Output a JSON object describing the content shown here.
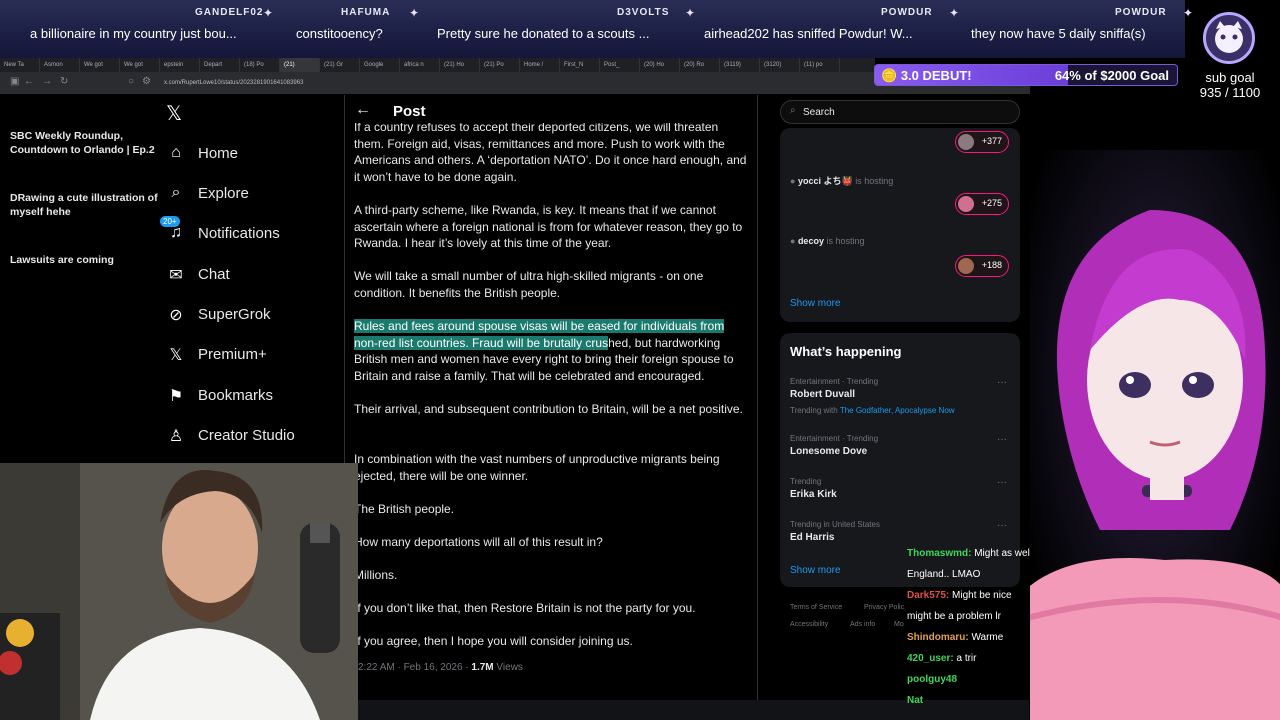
{
  "ticker": [
    {
      "user": "",
      "message": "a billionaire in my country just bou...",
      "userX": 0,
      "msgX": 30
    },
    {
      "user": "GANDELF02",
      "message": "constitooency?",
      "userX": 195,
      "msgX": 296
    },
    {
      "user": "HAFUMA",
      "message": "Pretty sure he donated to a scouts ...",
      "userX": 341,
      "msgX": 437
    },
    {
      "user": "D3VOLTS",
      "message": "airhead202 has sniffed Powdur! W...",
      "userX": 617,
      "msgX": 704
    },
    {
      "user": "POWDUR",
      "message": "they now have 5 daily sniffa(s)",
      "userX": 881,
      "msgX": 971
    },
    {
      "user": "POWDUR",
      "message": "",
      "userX": 1115,
      "msgX": 1185
    }
  ],
  "browser": {
    "tabs": [
      "New Ta",
      "Asmon",
      "We got",
      "We got",
      "epstein",
      "Depart",
      "(18) Po",
      "(21)",
      "(21) Gr",
      "Google",
      "africa n",
      "(21) Ho",
      "(21) Po",
      "Home /",
      "First_N",
      "Post_",
      "(20) Ho",
      "(20) Ro",
      "(3119)",
      "(3120)",
      "(11) po"
    ],
    "url": "x.com/RupertLowe10/status/2023281901641083963"
  },
  "sub_goal": {
    "banner_label": "3.0 DEBUT!",
    "progress_text": "64% of $2000 Goal",
    "progress_fraction": 0.64,
    "title": "sub goal",
    "count": "935 / 1100"
  },
  "nav": {
    "home": "Home",
    "explore": "Explore",
    "notifications": "Notifications",
    "notif_badge": "20+",
    "chat": "Chat",
    "supergrok": "SuperGrok",
    "premium": "Premium+",
    "bookmarks": "Bookmarks",
    "creator": "Creator Studio"
  },
  "post": {
    "header": "Post",
    "p1": "If a country refuses to accept their deported citizens, we will threaten them. Foreign aid, visas, remittances and more. Push to work with the Americans and others. A ‘deportation NATO’. Do it once hard enough, and it won’t have to be done again.",
    "p2": "A third-party scheme, like Rwanda, is key. It means that if we cannot ascertain where a foreign national is from for whatever reason, they go to Rwanda. I hear it’s lovely at this time of the year.",
    "p3": "We will take a small number of ultra high-skilled migrants - on one condition. It benefits the British people.",
    "p4_highlight": "Rules and fees around spouse visas will be eased for individuals from non-red list countries. Fraud will be brutally crus",
    "p4_rest": "hed, but hardworking British men and women have every right to bring their foreign spouse to Britain and raise a family. That will be celebrated and encouraged.",
    "p5": "Their arrival, and subsequent contribution to Britain, will be a net positive.",
    "p6": "In combination with the vast numbers of unproductive migrants being ejected, there will be one winner.",
    "p7": "The British people.",
    "p8": "How many deportations will all of this result in?",
    "p9": "Millions.",
    "p10": "If you don’t like that, then Restore Britain is not the party for you.",
    "p11": "If you agree, then I hope you will consider joining us.",
    "time": "2:22 AM · Feb 16, 2026 ·",
    "views_count": "1.7M",
    "views_label": "Views"
  },
  "search": {
    "placeholder": "Search"
  },
  "spaces": [
    {
      "host": "",
      "status": "",
      "title": "SBC Weekly Roundup, Countdown to Orlando | Ep.2",
      "count": "+377"
    },
    {
      "host": "yocci よち👹",
      "status": "is hosting",
      "title": "DRawing a cute illustration of myself hehe",
      "count": "+275"
    },
    {
      "host": "decoy",
      "status": "is hosting",
      "title": "Lawsuits are coming",
      "count": "+188"
    }
  ],
  "show_more": "Show more",
  "whats_happening": {
    "title": "What’s happening",
    "trends": [
      {
        "category": "Entertainment · Trending",
        "name": "Robert Duvall",
        "with_label": "Trending with",
        "with": "The Godfather, Apocalypse Now"
      },
      {
        "category": "Entertainment · Trending",
        "name": "Lonesome Dove",
        "with_label": "",
        "with": ""
      },
      {
        "category": "Trending",
        "name": "Erika Kirk",
        "with_label": "",
        "with": ""
      },
      {
        "category": "Trending in United States",
        "name": "Ed Harris",
        "with_label": "",
        "with": ""
      }
    ],
    "show_more": "Show more"
  },
  "footer": [
    "Terms of Service",
    "Privacy Polic",
    "Accessibility",
    "Ads info",
    "Mo"
  ],
  "chat": [
    {
      "user": "Thomaswmd:",
      "text": " Might as well.",
      "color": "#3fd65a"
    },
    {
      "user": "",
      "text": "England.. LMAO",
      "color": "#ffffff"
    },
    {
      "user": "Dark575:",
      "text": " Might be nice",
      "color": "#e05050"
    },
    {
      "user": "",
      "text": "might be a problem lr",
      "color": "#ffffff"
    },
    {
      "user": "Shindomaru:",
      "text": " Warme",
      "color": "#e0a050"
    },
    {
      "user": "420_user:",
      "text": " a trir",
      "color": "#3fd65a"
    },
    {
      "user": "poolguy48",
      "text": "",
      "color": "#3fd65a"
    },
    {
      "user": "Nat",
      "text": "",
      "color": "#3fd65a"
    }
  ],
  "colors": {
    "accent": "#1d9bf0",
    "highlight": "#1b7a6e",
    "pill_border": "#f91880",
    "goal_fill": "#8a5cf0"
  }
}
